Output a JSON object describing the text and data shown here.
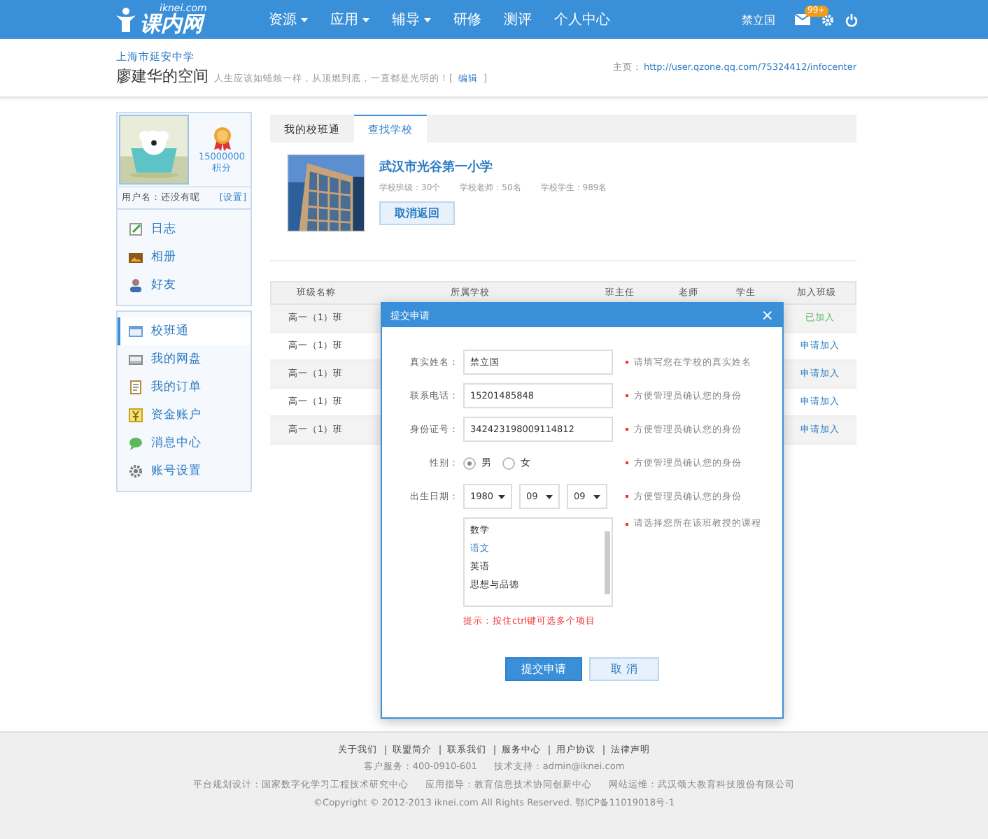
{
  "header": {
    "logo_domain": "iknei.com",
    "logo_name": "课内网",
    "nav": [
      {
        "label": "资源",
        "dropdown": true
      },
      {
        "label": "应用",
        "dropdown": true
      },
      {
        "label": "辅导",
        "dropdown": true
      },
      {
        "label": "研修",
        "dropdown": false
      },
      {
        "label": "测评",
        "dropdown": false
      },
      {
        "label": "个人中心",
        "dropdown": false
      }
    ],
    "user": "禁立国",
    "mail_badge": "99+"
  },
  "space": {
    "school": "上海市延安中学",
    "title": "廖建华的空间",
    "motto": "人生应该如蜡烛一样，从顶燃到底，一直都是光明的！[",
    "edit": "编辑",
    "motto_end": "]",
    "homepage_label": "主页：",
    "homepage_url": "http://user.qzone.qq.com/75324412/infocenter"
  },
  "profile": {
    "points": "15000000",
    "points_label": "积分",
    "username": "用户名：还没有呢",
    "settings": "[设置]"
  },
  "sidebar": {
    "personal": [
      {
        "label": "日志",
        "selected": false
      },
      {
        "label": "相册",
        "selected": false
      },
      {
        "label": "好友",
        "selected": false
      }
    ],
    "services": [
      {
        "label": "校班通",
        "selected": true
      },
      {
        "label": "我的网盘",
        "selected": false
      },
      {
        "label": "我的订单",
        "selected": false
      },
      {
        "label": "资金账户",
        "selected": false
      },
      {
        "label": "消息中心",
        "selected": false
      },
      {
        "label": "账号设置",
        "selected": false
      }
    ]
  },
  "tabs": [
    {
      "label": "我的校班通",
      "selected": false
    },
    {
      "label": "查找学校",
      "selected": true
    }
  ],
  "school": {
    "name": "武汉市光谷第一小学",
    "stats": [
      "学校班级：30个",
      "学校老师：50名",
      "学校学生：989名"
    ],
    "back_button": "取消返回"
  },
  "table": {
    "columns": [
      "班级名称",
      "所属学校",
      "班主任",
      "老师",
      "学生",
      "加入班级"
    ],
    "rows": [
      {
        "class": "高一（1）班",
        "join": "已加入",
        "kind": "joined"
      },
      {
        "class": "高一（1）班",
        "join": "申请加入",
        "kind": "apply"
      },
      {
        "class": "高一（1）班",
        "join": "申请加入",
        "kind": "apply"
      },
      {
        "class": "高一（1）班",
        "join": "申请加入",
        "kind": "apply"
      },
      {
        "class": "高一（1）班",
        "join": "申请加入",
        "kind": "apply"
      }
    ]
  },
  "dialog": {
    "title": "提交申请",
    "close": "×",
    "fields": [
      {
        "kind": "text",
        "label": "真实姓名：",
        "value": "禁立国",
        "hint": "请填写您在学校的真实姓名"
      },
      {
        "kind": "text",
        "label": "联系电话：",
        "value": "15201485848",
        "hint": "方便管理员确认您的身份"
      },
      {
        "kind": "text",
        "label": "身份证号：",
        "value": "342423198009114812",
        "hint": "方便管理员确认您的身份"
      },
      {
        "kind": "radio",
        "label": "性别：",
        "options": [
          {
            "label": "男",
            "selected": true
          },
          {
            "label": "女",
            "selected": false
          }
        ],
        "hint": "方便管理员确认您的身份"
      },
      {
        "kind": "date",
        "label": "出生日期：",
        "selects": [
          "1980",
          "09",
          "09"
        ],
        "hint": "方便管理员确认您的身份"
      },
      {
        "kind": "list",
        "options": [
          {
            "label": "数学",
            "selected": false
          },
          {
            "label": "语文",
            "selected": true
          },
          {
            "label": "英语",
            "selected": false
          },
          {
            "label": "思想与品德",
            "selected": false
          }
        ],
        "hint": "请选择您所在该班教授的课程"
      }
    ],
    "tip": "提示：按住ctrl键可选多个项目",
    "submit": "提交申请",
    "cancel": "取 消"
  },
  "footer": {
    "links": [
      "关于我们",
      "联盟简介",
      "联系我们",
      "服务中心",
      "用户协议",
      "法律声明"
    ],
    "contact": [
      "客户服务：400-0910-601",
      "技术支持：admin@iknei.com"
    ],
    "credits": [
      "平台规划设计：国家数字化学习工程技术研究中心",
      "应用指导：教育信息技术协同创新中心",
      "网站运维：武汉颂大教育科技股份有限公司"
    ],
    "copyright": "©Copyright © 2012-2013 iknei.com All Rights Reserved. 鄂ICP备11019018号-1"
  }
}
